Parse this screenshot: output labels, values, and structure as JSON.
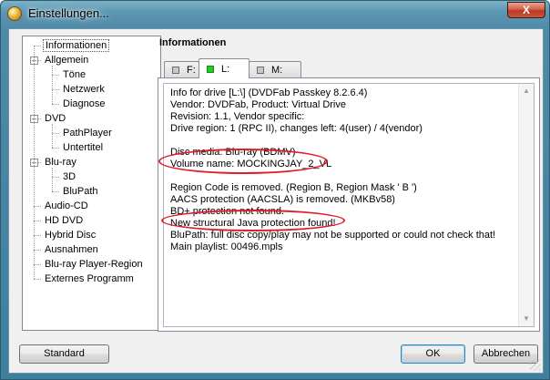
{
  "window": {
    "title": "Einstellungen...",
    "close_glyph": "X"
  },
  "tree": {
    "items": [
      {
        "label": "Informationen",
        "level": 0,
        "expander": ""
      },
      {
        "label": "Allgemein",
        "level": 0,
        "expander": "-"
      },
      {
        "label": "Töne",
        "level": 1,
        "expander": ""
      },
      {
        "label": "Netzwerk",
        "level": 1,
        "expander": ""
      },
      {
        "label": "Diagnose",
        "level": 1,
        "expander": ""
      },
      {
        "label": "DVD",
        "level": 0,
        "expander": "-"
      },
      {
        "label": "PathPlayer",
        "level": 1,
        "expander": ""
      },
      {
        "label": "Untertitel",
        "level": 1,
        "expander": ""
      },
      {
        "label": "Blu-ray",
        "level": 0,
        "expander": "-"
      },
      {
        "label": "3D",
        "level": 1,
        "expander": ""
      },
      {
        "label": "BluPath",
        "level": 1,
        "expander": ""
      },
      {
        "label": "Audio-CD",
        "level": 0,
        "expander": ""
      },
      {
        "label": "HD DVD",
        "level": 0,
        "expander": ""
      },
      {
        "label": "Hybrid Disc",
        "level": 0,
        "expander": ""
      },
      {
        "label": "Ausnahmen",
        "level": 0,
        "expander": ""
      },
      {
        "label": "Blu-ray Player-Region",
        "level": 0,
        "expander": ""
      },
      {
        "label": "Externes Programm",
        "level": 0,
        "expander": ""
      }
    ]
  },
  "panel": {
    "heading": "Informationen",
    "tabs": [
      {
        "label": "F:",
        "active": false
      },
      {
        "label": "L:",
        "active": true
      },
      {
        "label": "M:",
        "active": false
      }
    ],
    "info_lines": [
      "Info for drive [L:\\] (DVDFab Passkey 8.2.6.4)",
      "Vendor: DVDFab, Product: Virtual Drive",
      "Revision: 1.1, Vendor specific:",
      "Drive region: 1 (RPC II), changes left: 4(user) / 4(vendor)",
      "",
      "Disc media: Blu-ray (BDMV)",
      "Volume name: MOCKINGJAY_2_VL",
      "",
      "Region Code is removed. (Region B, Region Mask ' B ')",
      "AACS protection (AACSLA) is removed. (MKBv58)",
      "BD+ protection not found.",
      "New structural Java protection found!",
      "BluPath: full disc copy/play may not be supported or could not check that!",
      "Main playlist: 00496.mpls"
    ]
  },
  "buttons": {
    "standard": "Standard",
    "ok": "OK",
    "cancel": "Abbrechen"
  },
  "colors": {
    "annotation": "#e01b2a",
    "active_indicator": "#22cc22",
    "title_bar": "#4f8aa8"
  }
}
